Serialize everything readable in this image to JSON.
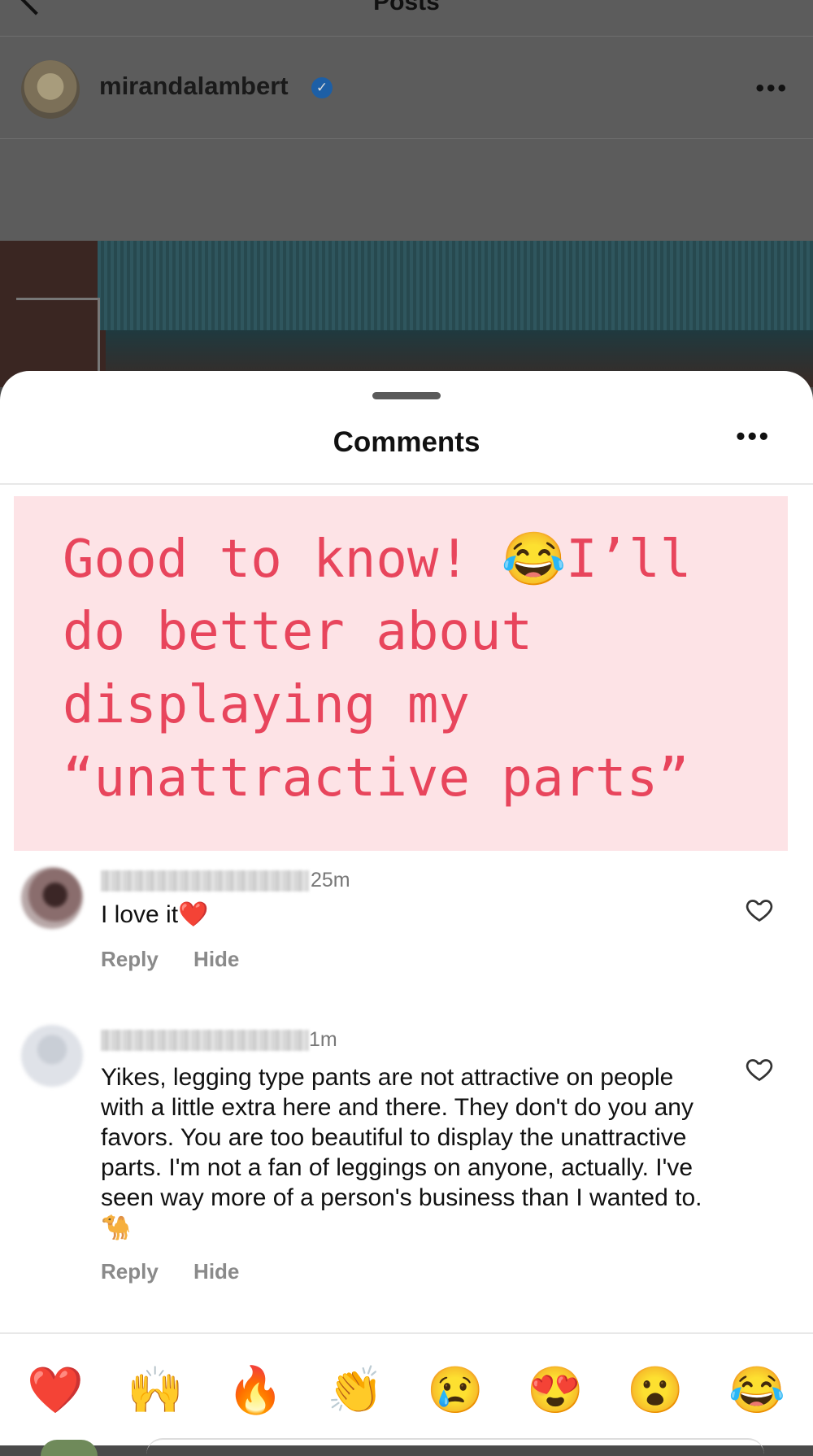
{
  "background": {
    "title": "Posts",
    "username": "mirandalambert"
  },
  "sheet": {
    "title": "Comments"
  },
  "quote": {
    "lines": [
      "Good to know! 😂I’ll",
      "do better about",
      "displaying my",
      "“unattractive parts”"
    ]
  },
  "comments": [
    {
      "time": "25m",
      "text": "I love it❤️",
      "reply_label": "Reply",
      "hide_label": "Hide"
    },
    {
      "time": "1m",
      "text": "Yikes, legging type pants are not attractive on people with a little extra here and there. They don't do you any favors. You are too beautiful to display the unattractive parts. I'm not a fan of leggings on anyone, actually.  I've seen way more of a person's business than I wanted to. 🐪",
      "reply_label": "Reply",
      "hide_label": "Hide"
    }
  ],
  "quick_reactions": [
    "❤️",
    "🙌",
    "🔥",
    "👏",
    "😢",
    "😍",
    "😮",
    "😂"
  ],
  "colors": {
    "quote_text": "#e8455c",
    "quote_bg": "#fde3e6"
  }
}
